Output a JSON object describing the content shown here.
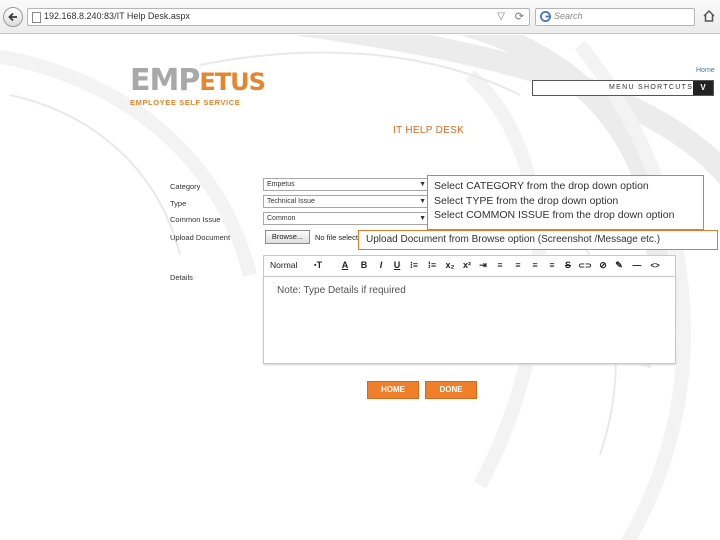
{
  "browser": {
    "url": "192.168.8.240:83/IT Help Desk.aspx",
    "search_placeholder": "Search",
    "icons": [
      "back-arrow-icon",
      "page-icon",
      "star-icon",
      "reload-icon",
      "google-icon",
      "home-icon"
    ]
  },
  "header": {
    "logo_part1": "EMP",
    "logo_part2": "ETUS",
    "logo_tagline": "EMPLOYEE SELF SERVICE",
    "home_link": "Home",
    "menu_shortcuts": "MENU SHORTCUTS",
    "menu_toggle": "V"
  },
  "page": {
    "title": "IT HELP DESK"
  },
  "form": {
    "category": {
      "label": "Category",
      "value": "Empetus"
    },
    "type": {
      "label": "Type",
      "value": "Technical Issue"
    },
    "common_issue": {
      "label": "Common Issue",
      "value": "Common"
    },
    "upload": {
      "label": "Upload Document",
      "button": "Browse...",
      "status": "No file selected"
    },
    "details": {
      "label": "Details"
    }
  },
  "editor": {
    "format": "Normal",
    "tools": [
      "ꞏT",
      "A",
      "B",
      "I",
      "U",
      "⁝≡",
      "⁞≡",
      "x₂",
      "x²",
      "⇥",
      "≡",
      "≡",
      "≡",
      "≡",
      "S",
      "⊂⊃",
      "⊘",
      "✎",
      "—",
      "<>"
    ],
    "note": "Note: Type Details if required"
  },
  "instructions": {
    "lines": [
      "Select CATEGORY from the drop down option",
      "Select TYPE from the drop down option",
      "Select COMMON ISSUE from the drop down option"
    ],
    "upload": "Upload Document from Browse option (Screenshot /Message etc.)"
  },
  "buttons": {
    "home": "HOME",
    "done": "DONE"
  },
  "colors": {
    "accent": "#e8842c",
    "title": "#e06a1e",
    "button": "#ef7f2a",
    "link": "#3e78b4"
  }
}
